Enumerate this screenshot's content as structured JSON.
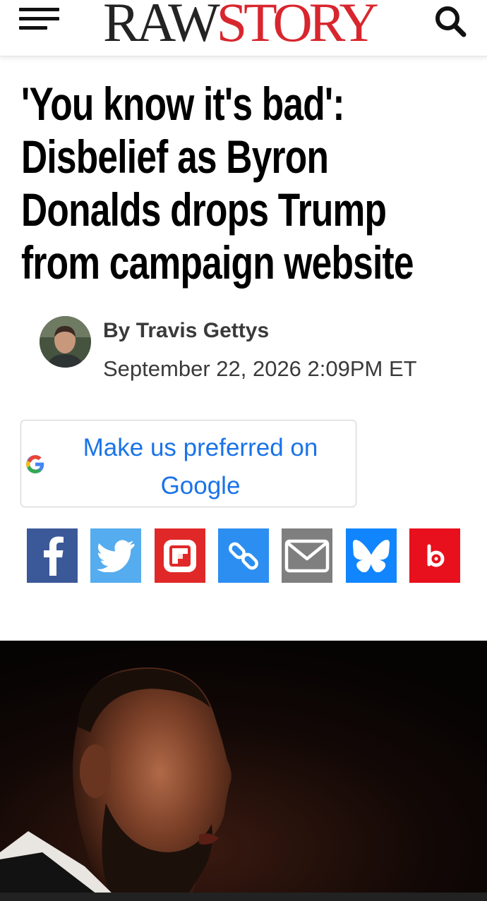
{
  "header": {
    "logo_raw": "RAW",
    "logo_story": "STORY",
    "menu_icon": "hamburger-menu-icon",
    "search_icon": "search-icon"
  },
  "article": {
    "headline": "'You know it's bad': Disbelief as Byron Donalds drops Trump from campaign website",
    "byline_prefix": "By",
    "author": "Travis Gettys",
    "date": "September 22, 2026 2:09PM ET"
  },
  "preferred_button": {
    "label": "Make us preferred on Google"
  },
  "share_buttons": [
    {
      "name": "facebook",
      "icon": "facebook-icon",
      "color": "#3b5998"
    },
    {
      "name": "twitter",
      "icon": "twitter-icon",
      "color": "#55acee"
    },
    {
      "name": "flipboard",
      "icon": "flipboard-icon",
      "color": "#e12828"
    },
    {
      "name": "copy-link",
      "icon": "link-icon",
      "color": "#2c8ef0"
    },
    {
      "name": "email",
      "icon": "email-icon",
      "color": "#7f7f7f"
    },
    {
      "name": "bluesky",
      "icon": "bluesky-icon",
      "color": "#1185fe"
    },
    {
      "name": "beehiiv",
      "icon": "beehiiv-icon",
      "color": "#e8101c"
    }
  ],
  "colors": {
    "brand_red": "#d8262e",
    "link_blue": "#1a73e8"
  }
}
